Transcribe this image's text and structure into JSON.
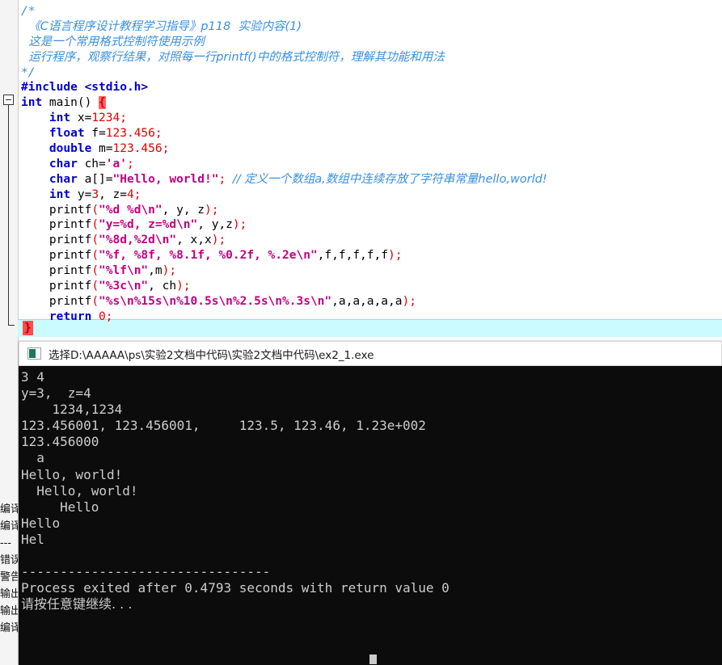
{
  "editor": {
    "name": "code-editor",
    "background": "#ffffff",
    "current_line_highlight": "#ccfbff",
    "colors": {
      "keyword": "#0000d0",
      "number": "#e00000",
      "string": "#c00080",
      "comment": "#3a8fe0",
      "brace_match_bg": "#ff4d4d"
    },
    "fold_marker": "minus",
    "code_lines": [
      {
        "id": "l1",
        "segments": [
          {
            "t": "/*",
            "c": "cmt"
          }
        ]
      },
      {
        "id": "l2",
        "segments": [
          {
            "t": "  《C语言程序设计教程学习指导》p118  实验内容(1)",
            "c": "cmt-cn"
          }
        ]
      },
      {
        "id": "l3",
        "segments": [
          {
            "t": "  这是一个常用格式控制符使用示例",
            "c": "cmt-cn"
          }
        ]
      },
      {
        "id": "l4",
        "segments": [
          {
            "t": "  运行程序，观察行结果，对照每一行printf()中的格式控制符，理解其功能和用法",
            "c": "cmt-cn"
          }
        ]
      },
      {
        "id": "l5",
        "segments": [
          {
            "t": "*/",
            "c": "cmt"
          }
        ]
      },
      {
        "id": "l6",
        "segments": [
          {
            "t": "#include <stdio.h>",
            "c": "kw"
          }
        ]
      },
      {
        "id": "l7",
        "segments": [
          {
            "t": "int",
            "c": "kw"
          },
          {
            "t": " main() ",
            "c": "fn"
          },
          {
            "t": "{",
            "c": "brace-hl"
          }
        ]
      },
      {
        "id": "l8",
        "segments": [
          {
            "t": "    ",
            "c": "fn"
          },
          {
            "t": "int",
            "c": "kw"
          },
          {
            "t": " x=",
            "c": "fn"
          },
          {
            "t": "1234",
            "c": "num"
          },
          {
            "t": ";",
            "c": "punc"
          }
        ]
      },
      {
        "id": "l9",
        "segments": [
          {
            "t": "    ",
            "c": "fn"
          },
          {
            "t": "float",
            "c": "kw"
          },
          {
            "t": " f=",
            "c": "fn"
          },
          {
            "t": "123.456",
            "c": "num"
          },
          {
            "t": ";",
            "c": "punc"
          }
        ]
      },
      {
        "id": "l10",
        "segments": [
          {
            "t": "    ",
            "c": "fn"
          },
          {
            "t": "double",
            "c": "kw"
          },
          {
            "t": " m=",
            "c": "fn"
          },
          {
            "t": "123.456",
            "c": "num"
          },
          {
            "t": ";",
            "c": "punc"
          }
        ]
      },
      {
        "id": "l11",
        "segments": [
          {
            "t": "    ",
            "c": "fn"
          },
          {
            "t": "char",
            "c": "kw"
          },
          {
            "t": " ch=",
            "c": "fn"
          },
          {
            "t": "'a'",
            "c": "str"
          },
          {
            "t": ";",
            "c": "punc"
          }
        ]
      },
      {
        "id": "l12",
        "segments": [
          {
            "t": "    ",
            "c": "fn"
          },
          {
            "t": "char",
            "c": "kw"
          },
          {
            "t": " a[]=",
            "c": "fn"
          },
          {
            "t": "\"Hello, world!\"",
            "c": "str"
          },
          {
            "t": ";",
            "c": "punc"
          },
          {
            "t": " ",
            "c": "fn"
          },
          {
            "t": "// 定义一个数组a,数组中连续存放了字符串常量hello,world!",
            "c": "cmt-cn"
          }
        ]
      },
      {
        "id": "l13",
        "segments": [
          {
            "t": "    ",
            "c": "fn"
          },
          {
            "t": "int",
            "c": "kw"
          },
          {
            "t": " y=",
            "c": "fn"
          },
          {
            "t": "3",
            "c": "num"
          },
          {
            "t": ", z=",
            "c": "fn"
          },
          {
            "t": "4",
            "c": "num"
          },
          {
            "t": ";",
            "c": "punc"
          }
        ]
      },
      {
        "id": "l14",
        "segments": [
          {
            "t": "    printf",
            "c": "fn"
          },
          {
            "t": "(",
            "c": "punc"
          },
          {
            "t": "\"%d %d\\n\"",
            "c": "str"
          },
          {
            "t": ", y, z",
            "c": "fn"
          },
          {
            "t": ")",
            "c": "punc"
          },
          {
            "t": ";",
            "c": "punc"
          }
        ]
      },
      {
        "id": "l15",
        "segments": [
          {
            "t": "    printf",
            "c": "fn"
          },
          {
            "t": "(",
            "c": "punc"
          },
          {
            "t": "\"y=%d, z=%d\\n\"",
            "c": "str"
          },
          {
            "t": ", y,z",
            "c": "fn"
          },
          {
            "t": ")",
            "c": "punc"
          },
          {
            "t": ";",
            "c": "punc"
          }
        ]
      },
      {
        "id": "l16",
        "segments": [
          {
            "t": "    printf",
            "c": "fn"
          },
          {
            "t": "(",
            "c": "punc"
          },
          {
            "t": "\"%8d,%2d\\n\"",
            "c": "str"
          },
          {
            "t": ", x,x",
            "c": "fn"
          },
          {
            "t": ")",
            "c": "punc"
          },
          {
            "t": ";",
            "c": "punc"
          }
        ]
      },
      {
        "id": "l17",
        "segments": [
          {
            "t": "    printf",
            "c": "fn"
          },
          {
            "t": "(",
            "c": "punc"
          },
          {
            "t": "\"%f, %8f, %8.1f, %0.2f, %.2e\\n\"",
            "c": "str"
          },
          {
            "t": ",f,f,f,f,f",
            "c": "fn"
          },
          {
            "t": ")",
            "c": "punc"
          },
          {
            "t": ";",
            "c": "punc"
          }
        ]
      },
      {
        "id": "l18",
        "segments": [
          {
            "t": "    printf",
            "c": "fn"
          },
          {
            "t": "(",
            "c": "punc"
          },
          {
            "t": "\"%lf\\n\"",
            "c": "str"
          },
          {
            "t": ",m",
            "c": "fn"
          },
          {
            "t": ")",
            "c": "punc"
          },
          {
            "t": ";",
            "c": "punc"
          }
        ]
      },
      {
        "id": "l19",
        "segments": [
          {
            "t": "    printf",
            "c": "fn"
          },
          {
            "t": "(",
            "c": "punc"
          },
          {
            "t": "\"%3c\\n\"",
            "c": "str"
          },
          {
            "t": ", ch",
            "c": "fn"
          },
          {
            "t": ")",
            "c": "punc"
          },
          {
            "t": ";",
            "c": "punc"
          }
        ]
      },
      {
        "id": "l20",
        "segments": [
          {
            "t": "    printf",
            "c": "fn"
          },
          {
            "t": "(",
            "c": "punc"
          },
          {
            "t": "\"%s\\n%15s\\n%10.5s\\n%2.5s\\n%.3s\\n\"",
            "c": "str"
          },
          {
            "t": ",a,a,a,a,a",
            "c": "fn"
          },
          {
            "t": ")",
            "c": "punc"
          },
          {
            "t": ";",
            "c": "punc"
          }
        ]
      },
      {
        "id": "l21",
        "segments": [
          {
            "t": "    ",
            "c": "fn"
          },
          {
            "t": "return",
            "c": "kw"
          },
          {
            "t": " ",
            "c": "fn"
          },
          {
            "t": "0",
            "c": "num"
          },
          {
            "t": ";",
            "c": "punc"
          }
        ]
      }
    ],
    "closing_brace": "}"
  },
  "left_panel": {
    "name": "tool-panel-strip",
    "labels": [
      "编译日志",
      "编译结果",
      "---",
      "错误",
      "警告",
      "输出",
      "输出",
      "编译"
    ]
  },
  "console": {
    "title": "选择D:\\AAAAA\\ps\\实验2文档中代码\\实验2文档中代码\\ex2_1.exe",
    "icon": "console-window-icon",
    "background": "#0c0c0c",
    "foreground": "#cccccc",
    "output_lines": [
      "3 4",
      "y=3,  z=4",
      "    1234,1234",
      "123.456001, 123.456001,     123.5, 123.46, 1.23e+002",
      "123.456000",
      "  a",
      "Hello, world!",
      "  Hello, world!",
      "     Hello",
      "Hello",
      "Hel",
      "",
      "--------------------------------",
      "Process exited after 0.4793 seconds with return value 0",
      "请按任意键继续. . ."
    ],
    "cursor_visible": true
  }
}
